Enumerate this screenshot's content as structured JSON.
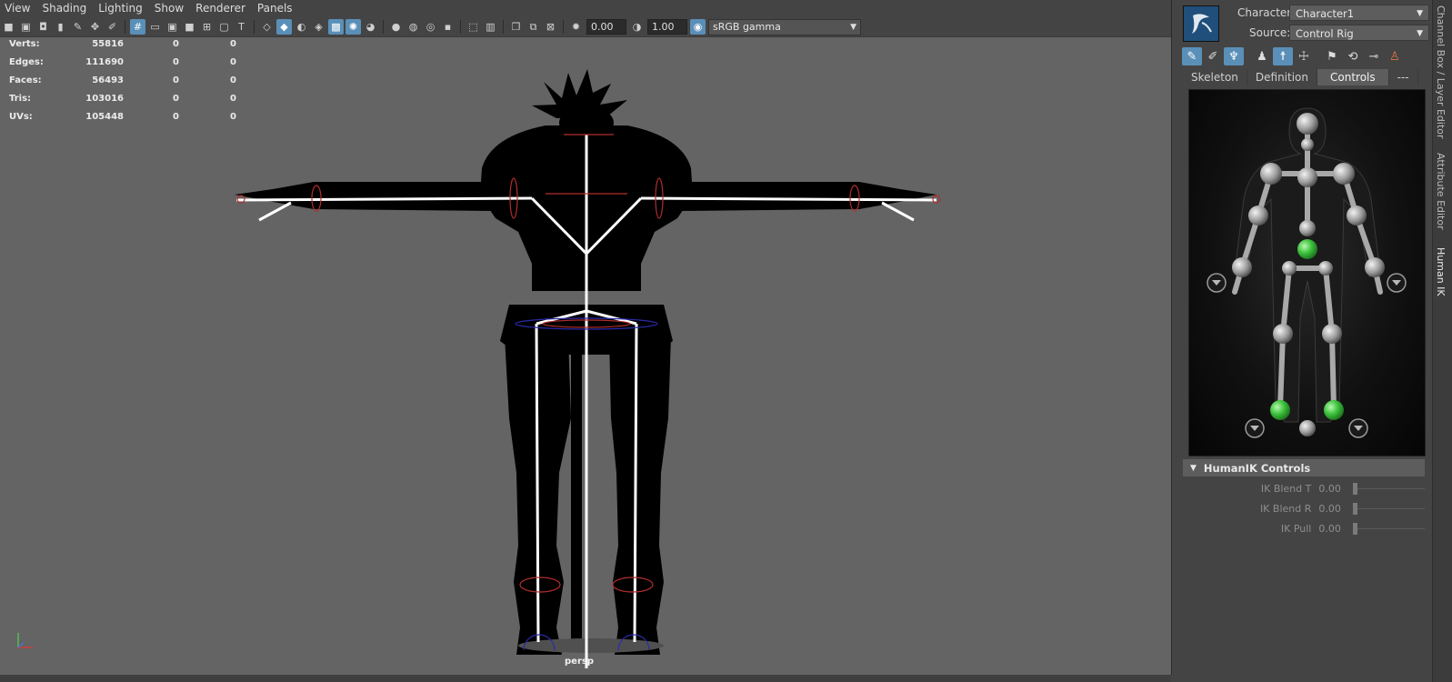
{
  "menu": [
    "View",
    "Shading",
    "Lighting",
    "Show",
    "Renderer",
    "Panels"
  ],
  "toolbar": {
    "exposure": "0.00",
    "gamma": "1.00",
    "color_space": "sRGB gamma"
  },
  "hud": {
    "rows": [
      {
        "label": "Verts:",
        "v1": "55816",
        "v2": "0",
        "v3": "0"
      },
      {
        "label": "Edges:",
        "v1": "111690",
        "v2": "0",
        "v3": "0"
      },
      {
        "label": "Faces:",
        "v1": "56493",
        "v2": "0",
        "v3": "0"
      },
      {
        "label": "Tris:",
        "v1": "103016",
        "v2": "0",
        "v3": "0"
      },
      {
        "label": "UVs:",
        "v1": "105448",
        "v2": "0",
        "v3": "0"
      }
    ]
  },
  "viewport": {
    "camera": "persp"
  },
  "panel": {
    "character_label": "Character:",
    "character_value": "Character1",
    "source_label": "Source:",
    "source_value": "Control Rig",
    "tabs": [
      "Skeleton",
      "Definition",
      "Controls",
      "---"
    ],
    "selected_tab": "Controls",
    "section_title": "HumanIK Controls",
    "attributes": [
      {
        "label": "IK Blend T",
        "value": "0.00"
      },
      {
        "label": "IK Blend R",
        "value": "0.00"
      },
      {
        "label": "IK Pull",
        "value": "0.00"
      }
    ]
  },
  "side_tabs": [
    "Channel Box / Layer Editor",
    "Attribute Editor",
    "Human IK"
  ],
  "colors": {
    "viewport_bg": "#646464",
    "panel_bg": "#444444",
    "accent": "#5a8fb8",
    "effector_active": "#3ec43e"
  }
}
